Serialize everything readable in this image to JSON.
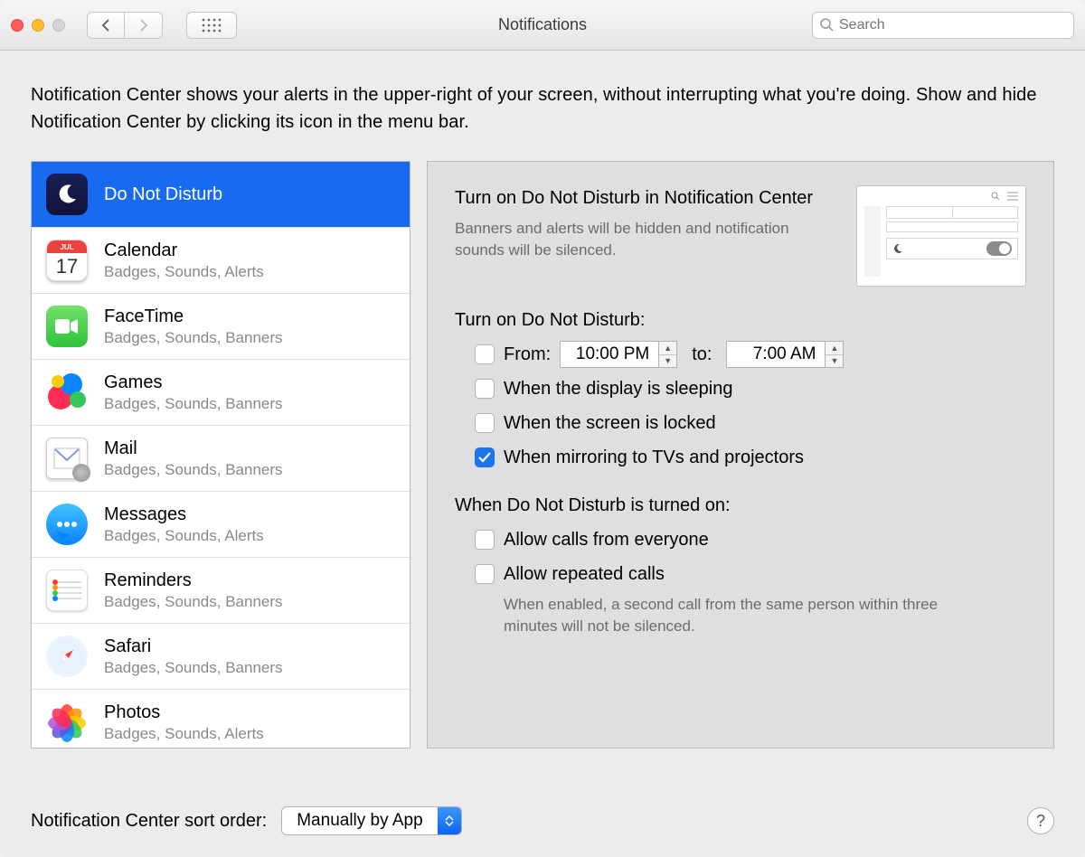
{
  "window": {
    "title": "Notifications"
  },
  "search": {
    "placeholder": "Search"
  },
  "intro": "Notification Center shows your alerts in the upper-right of your screen, without interrupting what you're doing. Show and hide Notification Center by clicking its icon in the menu bar.",
  "sidebar": {
    "items": [
      {
        "name": "Do Not Disturb",
        "sub": ""
      },
      {
        "name": "Calendar",
        "sub": "Badges, Sounds, Alerts",
        "cal_month": "JUL",
        "cal_day": "17"
      },
      {
        "name": "FaceTime",
        "sub": "Badges, Sounds, Banners"
      },
      {
        "name": "Games",
        "sub": "Badges, Sounds, Banners"
      },
      {
        "name": "Mail",
        "sub": "Badges, Sounds, Banners"
      },
      {
        "name": "Messages",
        "sub": "Badges, Sounds, Alerts"
      },
      {
        "name": "Reminders",
        "sub": "Badges, Sounds, Banners"
      },
      {
        "name": "Safari",
        "sub": "Badges, Sounds, Banners"
      },
      {
        "name": "Photos",
        "sub": "Badges, Sounds, Alerts"
      }
    ]
  },
  "detail": {
    "heading": "Turn on Do Not Disturb in Notification Center",
    "subheading": "Banners and alerts will be hidden and notification sounds will be silenced.",
    "section1_title": "Turn on Do Not Disturb:",
    "from_label": "From:",
    "from_value": "10:00 PM",
    "to_label": "to:",
    "to_value": "7:00 AM",
    "opt_sleep": "When the display is sleeping",
    "opt_locked": "When the screen is locked",
    "opt_mirror": "When mirroring to TVs and projectors",
    "section2_title": "When Do Not Disturb is turned on:",
    "opt_everyone": "Allow calls from everyone",
    "opt_repeat": "Allow repeated calls",
    "repeat_help": "When enabled, a second call from the same person within three minutes will not be silenced.",
    "checks": {
      "from": false,
      "sleep": false,
      "locked": false,
      "mirror": true,
      "everyone": false,
      "repeat": false
    }
  },
  "footer": {
    "sort_label": "Notification Center sort order:",
    "sort_value": "Manually by App",
    "help": "?"
  }
}
